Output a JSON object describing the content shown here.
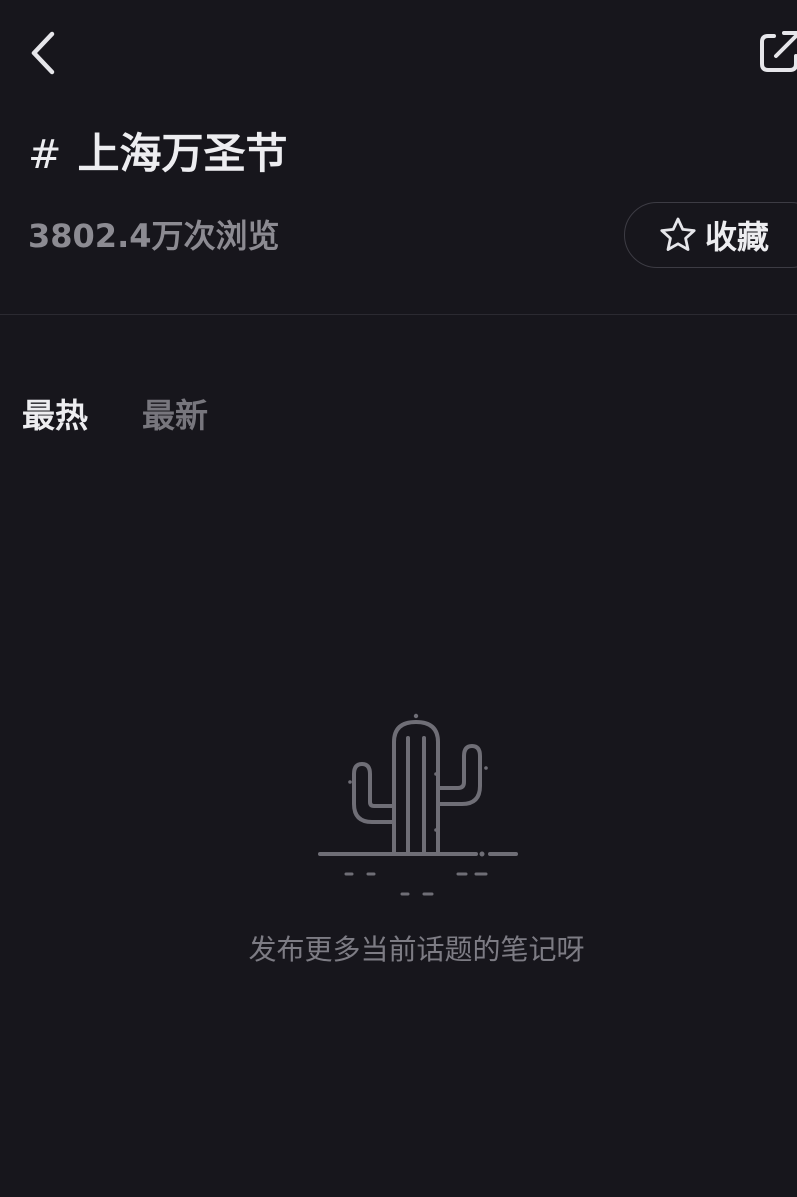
{
  "header": {
    "back_icon": "chevron-left-icon",
    "share_icon": "share-icon"
  },
  "topic": {
    "hash": "#",
    "name": "上海万圣节",
    "views": "3802.4万次浏览"
  },
  "favorite": {
    "icon": "star-outline-icon",
    "label": "收藏"
  },
  "tabs": [
    {
      "label": "最热",
      "active": true
    },
    {
      "label": "最新",
      "active": false
    }
  ],
  "empty_state": {
    "illustration": "cactus-icon",
    "message": "发布更多当前话题的笔记呀"
  },
  "colors": {
    "background": "#17161c",
    "primary_text": "#ededf0",
    "secondary_text": "#8c8b92",
    "illustration": "#6f6e76"
  }
}
